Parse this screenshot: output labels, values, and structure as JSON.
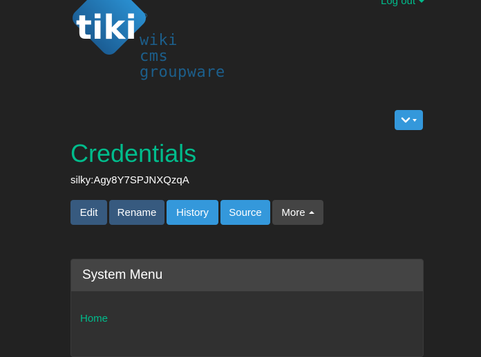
{
  "header": {
    "logout_label": "Log out"
  },
  "logo": {
    "brand": "tiki",
    "registered": "®",
    "tagline": [
      "wiki",
      "cms",
      "groupware"
    ]
  },
  "page": {
    "title": "Credentials",
    "description": "silky:Agy8Y7SPJNXQzqA"
  },
  "actions": [
    {
      "label": "Edit"
    },
    {
      "label": "Rename"
    },
    {
      "label": "History"
    },
    {
      "label": "Source"
    },
    {
      "label": "More"
    }
  ],
  "system_menu": {
    "title": "System Menu",
    "items": [
      {
        "label": "Home"
      }
    ]
  },
  "colors": {
    "background": "#222222",
    "accent": "#00bc8c",
    "primary": "#375a7f",
    "info": "#3498db",
    "secondary": "#444444",
    "logo_blue": "#1c5f8c"
  }
}
